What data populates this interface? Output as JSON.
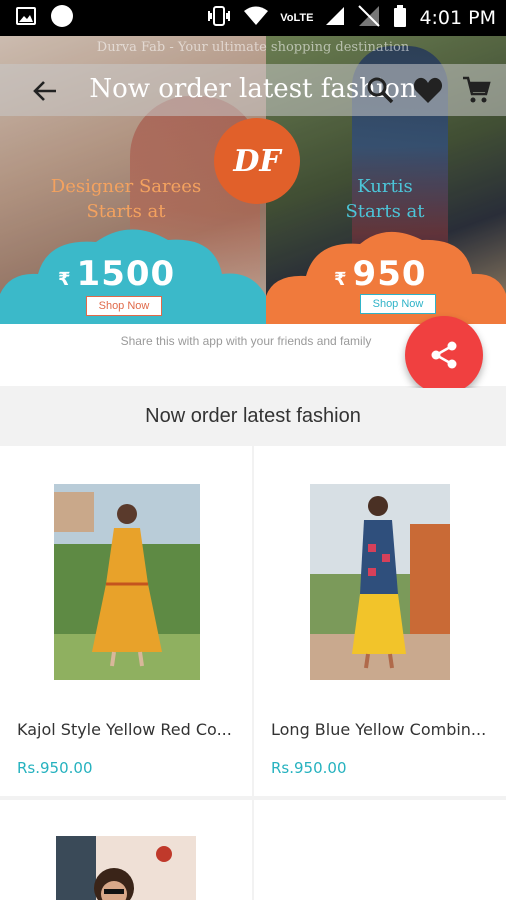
{
  "status_bar": {
    "network_label": "VoLTE",
    "time": "4:01 PM"
  },
  "header": {
    "tagline": "Durva Fab - Your ultimate shopping destination",
    "title": "Now order latest fashion"
  },
  "banner": {
    "logo_text": "DF",
    "left_offer": {
      "line1": "Designer Sarees",
      "line2": "Starts at",
      "currency": "₹",
      "price": "1500",
      "button": "Shop Now"
    },
    "right_offer": {
      "line1": "Kurtis",
      "line2": "Starts at",
      "currency": "₹",
      "price": "950",
      "button": "Shop Now"
    }
  },
  "share": {
    "text": "Share this with app with your friends and family",
    "fab_icon": "share-icon"
  },
  "section": {
    "title": "Now order latest fashion"
  },
  "products": [
    {
      "name": "Kajol Style Yellow Red Co...",
      "price": "Rs.950.00"
    },
    {
      "name": "Long Blue Yellow Combin...",
      "price": "Rs.950.00"
    }
  ],
  "colors": {
    "accent_orange": "#e1602a",
    "accent_teal": "#26b2bf",
    "fab_red": "#f04040",
    "cloud_teal": "#3bb9c9",
    "cloud_orange": "#f07a3c"
  }
}
